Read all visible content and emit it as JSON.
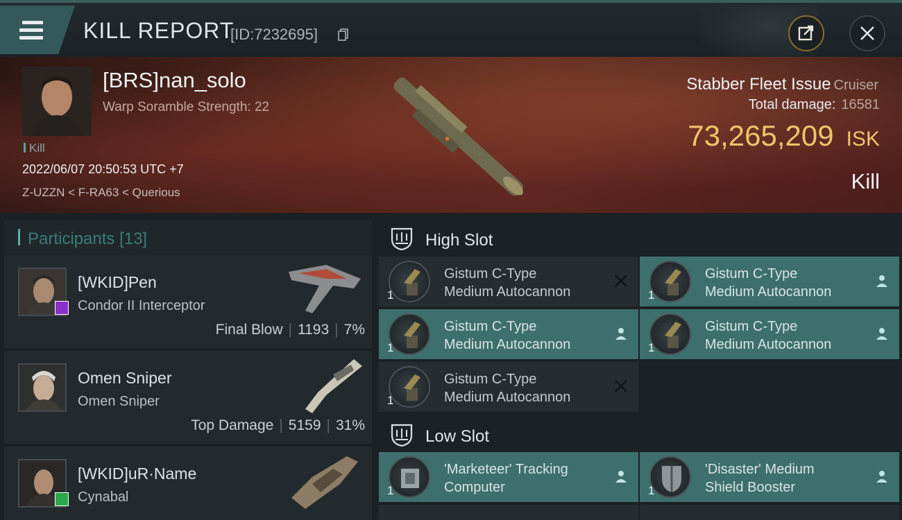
{
  "header": {
    "title": "KILL REPORT",
    "report_id": "[ID:7232695]",
    "icons": {
      "menu": "hamburger-icon",
      "copy": "copy-icon",
      "share": "share-icon",
      "close": "close-icon"
    }
  },
  "victim": {
    "name": "[BRS]nan_solo",
    "scramble": "Warp Soramble Strength: 22",
    "kill_tag": "Kill",
    "timestamp": "2022/06/07 20:50:53 UTC +7",
    "location": "Z-UZZN < F-RA63 < Querious",
    "ship_name": "Stabber Fleet Issue",
    "ship_class": "Cruiser",
    "total_damage_label": "Total damage:",
    "total_damage_value": "16581",
    "isk_amount": "73,265,209",
    "isk_unit": "ISK",
    "result_label": "Kill"
  },
  "participants": {
    "label": "Participants",
    "count": "[13]",
    "rows": [
      {
        "name": "[WKID]Pen",
        "ship": "Condor II Interceptor",
        "stat_label": "Final Blow",
        "damage": "1193",
        "percent": "7%",
        "badge_color": "#8b2fc9"
      },
      {
        "name": "Omen Sniper",
        "ship": "Omen Sniper",
        "stat_label": "Top Damage",
        "damage": "5159",
        "percent": "31%",
        "badge_color": ""
      },
      {
        "name": "[WKID]uR·Name",
        "ship": "Cynabal",
        "stat_label": "",
        "damage": "",
        "percent": "",
        "badge_color": "#2aa84a"
      }
    ]
  },
  "slots": {
    "high_label": "High Slot",
    "low_label": "Low Slot",
    "high": [
      {
        "qty": "1",
        "line1": "Gistum C-Type",
        "line2": "Medium Autocannon",
        "state": "destroyed"
      },
      {
        "qty": "1",
        "line1": "Gistum C-Type",
        "line2": "Medium Autocannon",
        "state": "dropped"
      },
      {
        "qty": "1",
        "line1": "Gistum C-Type",
        "line2": "Medium Autocannon",
        "state": "dropped"
      },
      {
        "qty": "1",
        "line1": "Gistum C-Type",
        "line2": "Medium Autocannon",
        "state": "dropped"
      },
      {
        "qty": "1",
        "line1": "Gistum C-Type",
        "line2": "Medium Autocannon",
        "state": "destroyed"
      }
    ],
    "low": [
      {
        "qty": "1",
        "line1": "'Marketeer' Tracking",
        "line2": "Computer",
        "state": "dropped"
      },
      {
        "qty": "1",
        "line1": "'Disaster' Medium",
        "line2": "Shield Booster",
        "state": "dropped"
      }
    ]
  },
  "colors": {
    "accent_teal": "#3d6f6c",
    "isk_gold": "#f0c46a",
    "banner_red": "#4b2218"
  }
}
